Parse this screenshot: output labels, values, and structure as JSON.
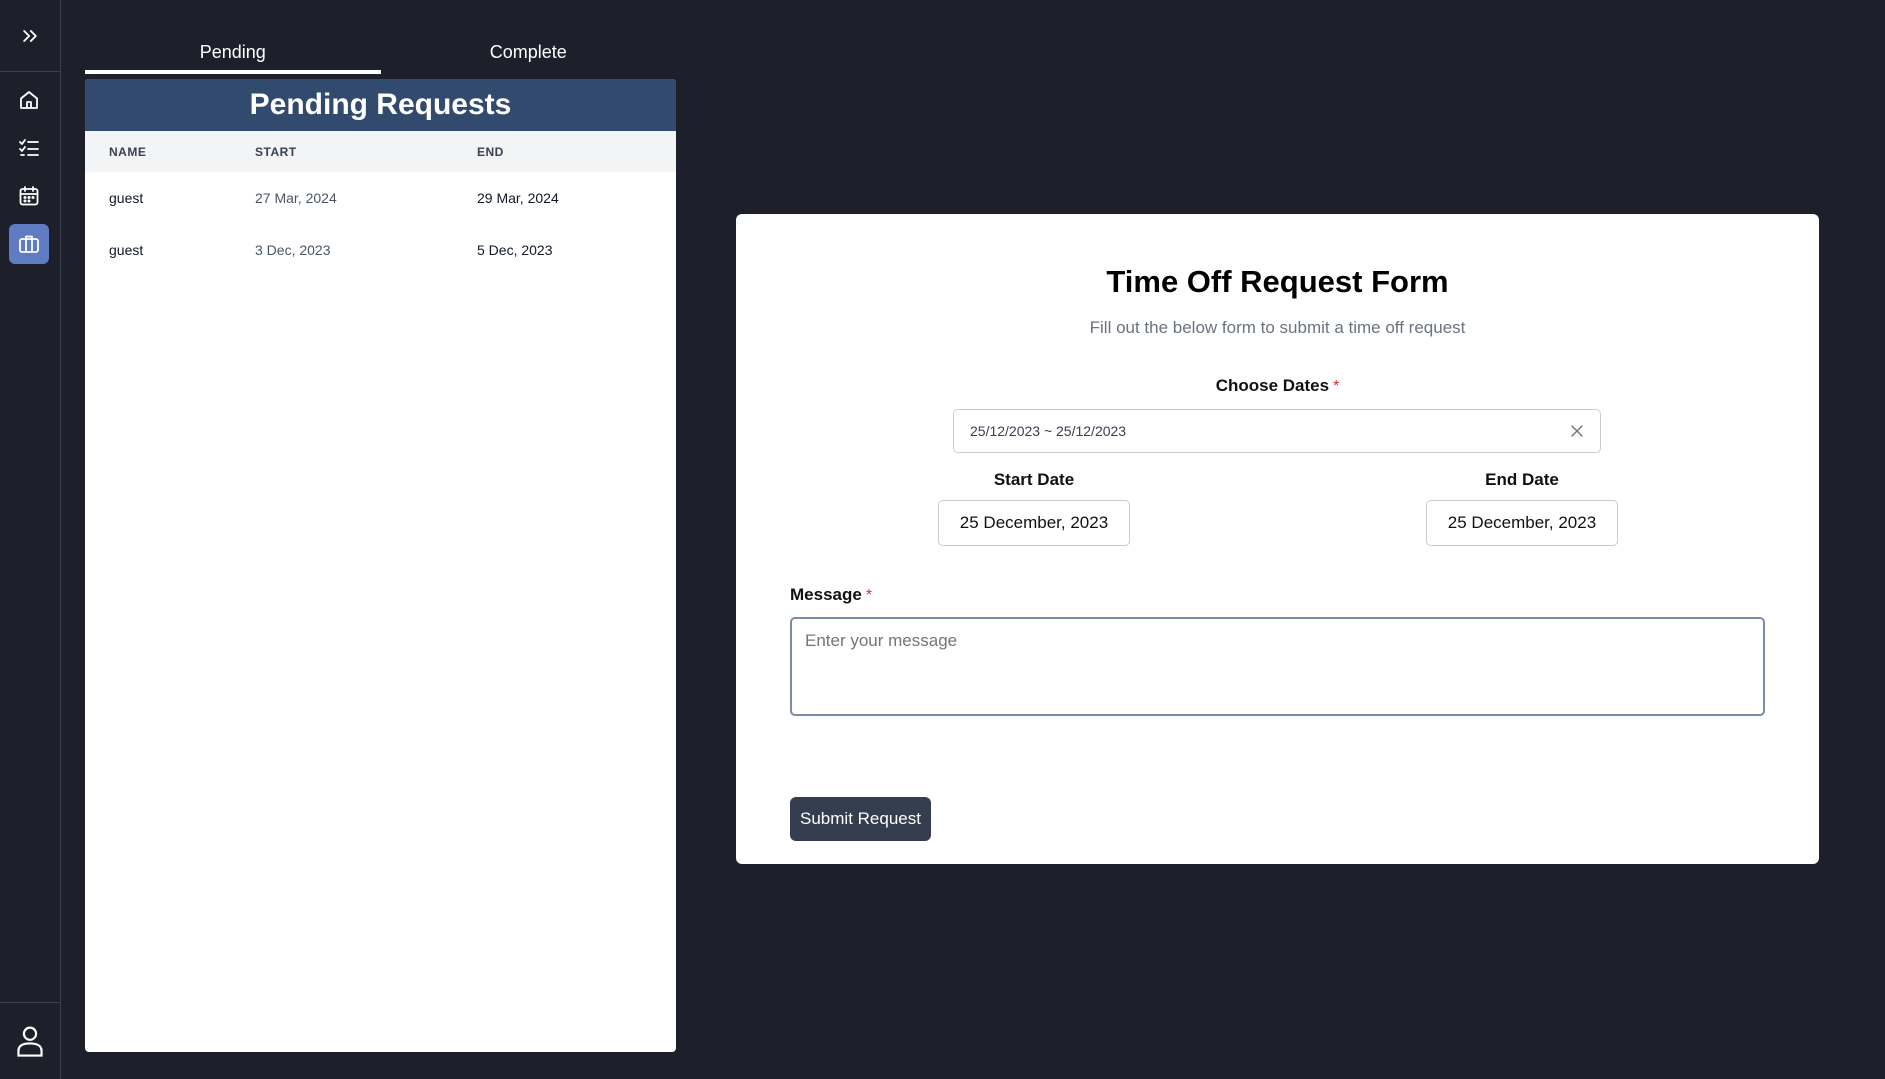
{
  "tabs": [
    {
      "label": "Pending"
    },
    {
      "label": "Complete"
    }
  ],
  "pending": {
    "title": "Pending Requests",
    "columns": [
      "NAME",
      "START",
      "END"
    ],
    "rows": [
      {
        "name": "guest",
        "start": "27 Mar, 2024",
        "end": "29 Mar, 2024"
      },
      {
        "name": "guest",
        "start": "3 Dec, 2023",
        "end": "5 Dec, 2023"
      }
    ]
  },
  "form": {
    "title": "Time Off Request Form",
    "subtitle": "Fill out the below form to submit a time off request",
    "choose_dates_label": "Choose Dates",
    "required_mark": "*",
    "date_range_value": "25/12/2023 ~ 25/12/2023",
    "start_date_label": "Start Date",
    "start_date_value": "25 December, 2023",
    "end_date_label": "End Date",
    "end_date_value": "25 December, 2023",
    "message_label": "Message",
    "message_placeholder": "Enter your message",
    "submit_label": "Submit Request"
  },
  "sidebar": {
    "icons": [
      "chevrons-right-icon",
      "home-icon",
      "checklist-icon",
      "calendar-icon",
      "briefcase-icon",
      "user-icon"
    ],
    "active": "briefcase-icon"
  },
  "colors": {
    "background": "#1d202a",
    "header": "#324a6e",
    "active_nav": "#5e7bc4",
    "button": "#353e4f",
    "required": "#d93025"
  }
}
